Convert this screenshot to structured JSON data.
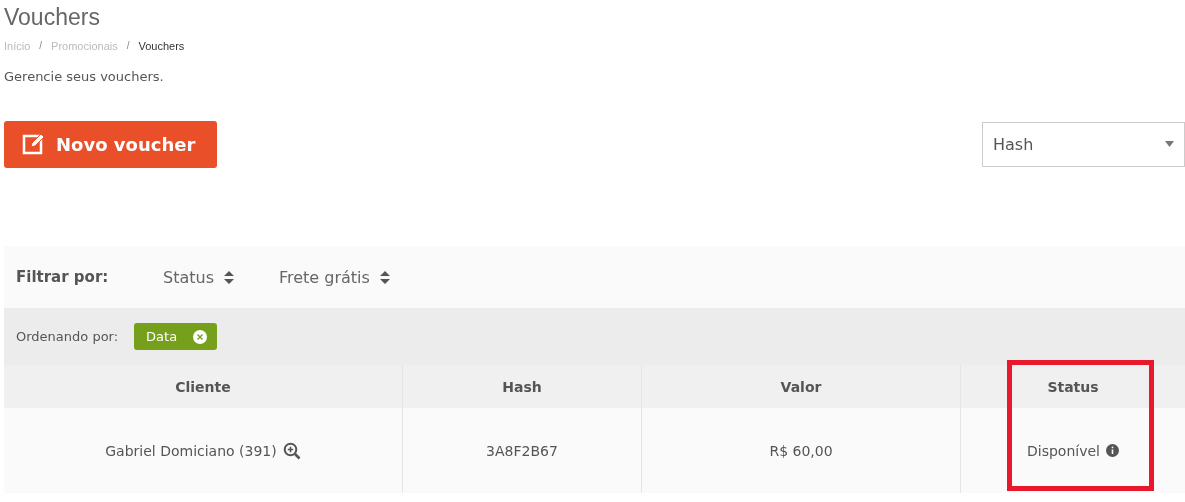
{
  "page": {
    "title": "Vouchers",
    "subtitle": "Gerencie seus vouchers."
  },
  "breadcrumb": {
    "separator": "/",
    "items": [
      {
        "label": "Início",
        "current": false
      },
      {
        "label": "Promocionais",
        "current": false
      },
      {
        "label": "Vouchers",
        "current": true
      }
    ]
  },
  "new_button": {
    "label": "Novo voucher"
  },
  "search_select": {
    "value": "Hash"
  },
  "filter_bar": {
    "label": "Filtrar por:",
    "filters": [
      "Status",
      "Frete grátis"
    ]
  },
  "sort_bar": {
    "label": "Ordenando por:",
    "tags": [
      "Data"
    ]
  },
  "table": {
    "columns": [
      {
        "label": "Cliente",
        "highlighted": false
      },
      {
        "label": "Hash",
        "highlighted": false
      },
      {
        "label": "Valor",
        "highlighted": false
      },
      {
        "label": "Status",
        "highlighted": true
      }
    ],
    "rows": [
      {
        "cliente": "Gabriel Domiciano (391)",
        "hash": "3A8F2B67",
        "valor": "R$ 60,00",
        "status": "Disponível"
      }
    ]
  }
}
